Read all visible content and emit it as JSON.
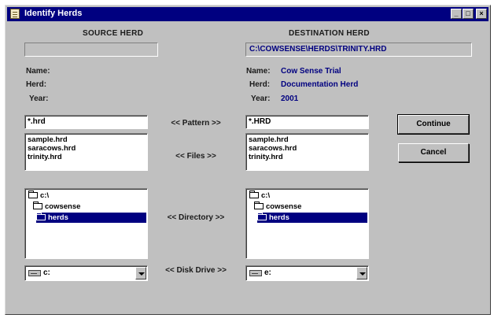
{
  "window": {
    "title": "Identify Herds"
  },
  "source": {
    "heading": "SOURCE HERD",
    "path": "",
    "labels": {
      "name": "Name:",
      "herd": "Herd:",
      "year": "Year:"
    },
    "pattern": "*.hrd",
    "files": [
      "sample.hrd",
      "saracows.hrd",
      "trinity.hrd"
    ],
    "directories": [
      "c:\\",
      "cowsense",
      "herds"
    ],
    "drive": "c:"
  },
  "destination": {
    "heading": "DESTINATION HERD",
    "path": "C:\\COWSENSE\\HERDS\\TRINITY.HRD",
    "labels": {
      "name": "Name:",
      "herd": "Herd:",
      "year": "Year:"
    },
    "values": {
      "name": "Cow Sense Trial",
      "herd": "Documentation Herd",
      "year": "2001"
    },
    "pattern": "*.HRD",
    "files": [
      "sample.hrd",
      "saracows.hrd",
      "trinity.hrd"
    ],
    "directories": [
      "c:\\",
      "cowsense",
      "herds"
    ],
    "drive": "e:"
  },
  "transfer": {
    "pattern": "<< Pattern >>",
    "files": "<< Files >>",
    "directory": "<< Directory >>",
    "disk_drive": "<< Disk Drive >>"
  },
  "buttons": {
    "continue": "Continue",
    "cancel": "Cancel"
  },
  "icons": {
    "app": "notebook-icon",
    "folder": "folder-icon",
    "drive": "drive-icon"
  }
}
